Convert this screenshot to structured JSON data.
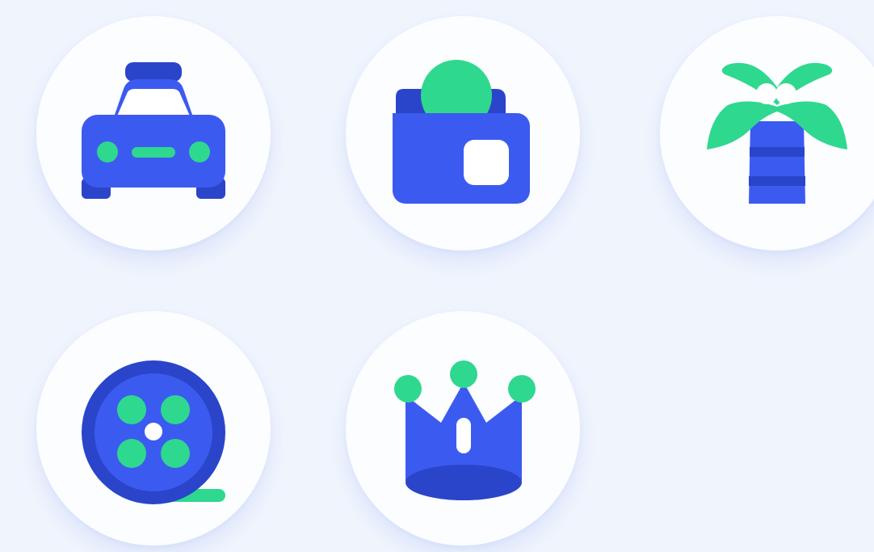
{
  "palette": {
    "background": "#f0f5fd",
    "tile": "#fcfdff",
    "primary_blue": "#3b5bf0",
    "dark_blue": "#2a45c9",
    "accent_green": "#2fd88f",
    "white": "#ffffff"
  },
  "icons": [
    {
      "name": "taxi-icon"
    },
    {
      "name": "wallet-icon"
    },
    {
      "name": "palm-tree-icon"
    },
    {
      "name": "film-reel-icon"
    },
    {
      "name": "crown-icon"
    }
  ]
}
